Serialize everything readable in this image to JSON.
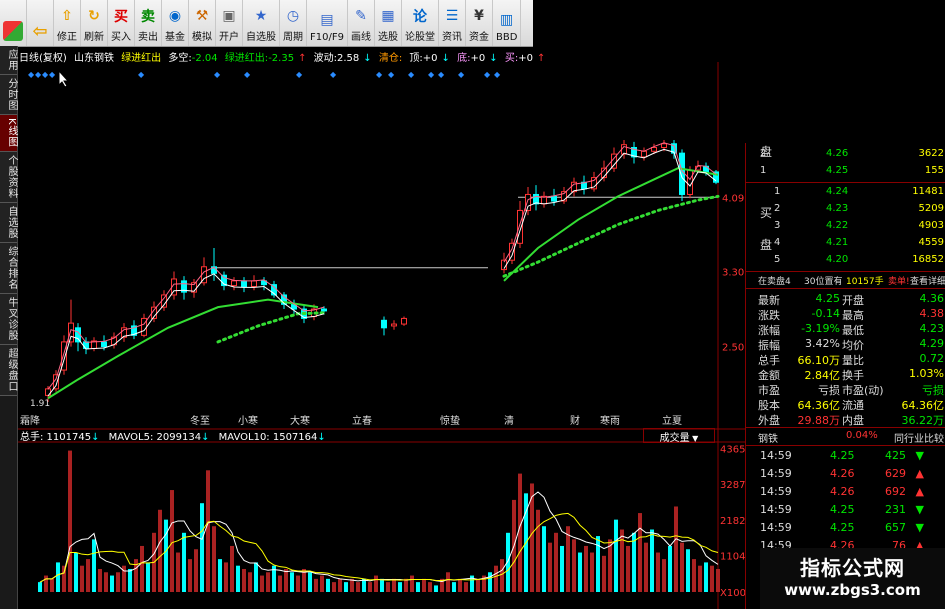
{
  "toolbar": {
    "items": [
      {
        "label": "",
        "icon": "window-icon"
      },
      {
        "label": "",
        "icon": "back-arrow-icon"
      },
      {
        "label": "修正",
        "icon": "up-arrow-icon"
      },
      {
        "label": "刷新",
        "icon": "refresh-icon"
      },
      {
        "label": "买入",
        "icon": "buy-icon",
        "glyph": "买"
      },
      {
        "label": "卖出",
        "icon": "sell-icon",
        "glyph": "卖"
      },
      {
        "label": "基金",
        "icon": "fund-icon"
      },
      {
        "label": "模拟",
        "icon": "hammer-icon"
      },
      {
        "label": "开户",
        "icon": "lock-icon"
      },
      {
        "label": "自选股",
        "icon": "star-icon"
      },
      {
        "label": "周期",
        "icon": "clock-icon"
      },
      {
        "label": "F10/F9",
        "icon": "f10-icon"
      },
      {
        "label": "画线",
        "icon": "pen-icon"
      },
      {
        "label": "选股",
        "icon": "screen-icon"
      },
      {
        "label": "论股堂",
        "icon": "discuss-icon",
        "glyph": "论"
      },
      {
        "label": "资讯",
        "icon": "news-icon"
      },
      {
        "label": "资金",
        "icon": "money-icon"
      },
      {
        "label": "BBD",
        "icon": "bbd-icon"
      }
    ]
  },
  "side_tabs": [
    "应用",
    "分时图",
    "K线图",
    "个股资料",
    "自选股",
    "综合排名",
    "牛叉诊股",
    "超级盘口"
  ],
  "indicator_line": {
    "period": "日线(复权)",
    "stock": "山东钢铁",
    "signal1": "绿进红出",
    "duokong": "多空:",
    "duokong_val": "-2.04",
    "signal2": "绿进红出:",
    "signal2_val": "-2.35",
    "bodong": "波动:",
    "bodong_val": "2.58",
    "qingcang": "清仓:",
    "ding": "顶:",
    "ding_val": "+0",
    "di": "底:",
    "di_val": "+0",
    "mai": "买:",
    "mai_val": "+0"
  },
  "price_axis": [
    "4.09",
    "3.30",
    "2.50"
  ],
  "low_label": "1.91",
  "date_labels": [
    "霜降",
    "冬至",
    "小寒",
    "大寒",
    "立春",
    "惊蛰",
    "清",
    "财",
    "寒雨",
    "立夏"
  ],
  "volume_header": {
    "total": "总手: 1101745",
    "mavol5": "MAVOL5: 2099134",
    "mavol10": "MAVOL10: 1507164",
    "dropdown": "成交量"
  },
  "volume_axis": [
    "43650",
    "32872",
    "21825",
    "11047",
    "X100"
  ],
  "order_book": {
    "side_sell": "盘",
    "side_buy1": "买",
    "side_buy2": "盘",
    "sell": [
      {
        "lvl": "2",
        "price": "4.26",
        "vol": "3622"
      },
      {
        "lvl": "1",
        "price": "4.25",
        "vol": "155"
      }
    ],
    "buy": [
      {
        "lvl": "1",
        "price": "4.24",
        "vol": "11481"
      },
      {
        "lvl": "2",
        "price": "4.23",
        "vol": "5209"
      },
      {
        "lvl": "3",
        "price": "4.22",
        "vol": "4903"
      },
      {
        "lvl": "4",
        "price": "4.21",
        "vol": "4559"
      },
      {
        "lvl": "5",
        "price": "4.20",
        "vol": "16852"
      }
    ]
  },
  "bar_row": {
    "a": "在卖盘4",
    "b": "30位置有",
    "c": "10157手",
    "d": "卖单!",
    "e": "查看详细"
  },
  "stats": [
    {
      "k1": "最新",
      "v1": "4.25",
      "k2": "开盘",
      "v2": "4.36"
    },
    {
      "k1": "涨跌",
      "v1": "-0.14",
      "k2": "最高",
      "v2": "4.38"
    },
    {
      "k1": "涨幅",
      "v1": "-3.19%",
      "k2": "最低",
      "v2": "4.23"
    },
    {
      "k1": "振幅",
      "v1": "3.42%",
      "k2": "均价",
      "v2": "4.29"
    },
    {
      "k1": "总手",
      "v1": "66.10万",
      "k2": "量比",
      "v2": "0.72"
    },
    {
      "k1": "金额",
      "v1": "2.84亿",
      "k2": "换手",
      "v2": "1.03%"
    },
    {
      "k1": "市盈",
      "v1": "亏损",
      "k2": "市盈(动)",
      "v2": "亏损"
    },
    {
      "k1": "股本",
      "v1": "64.36亿",
      "k2": "流通",
      "v2": "64.36亿"
    },
    {
      "k1": "外盘",
      "v1": "29.88万",
      "k2": "内盘",
      "v2": "36.22万"
    }
  ],
  "industry_row": {
    "name": "钢铁",
    "pct": "0.04%",
    "link": "同行业比较"
  },
  "ticks": [
    {
      "time": "14:59",
      "price": "4.25",
      "vol": "425",
      "dir": "down"
    },
    {
      "time": "14:59",
      "price": "4.26",
      "vol": "629",
      "dir": "up"
    },
    {
      "time": "14:59",
      "price": "4.26",
      "vol": "692",
      "dir": "up"
    },
    {
      "time": "14:59",
      "price": "4.25",
      "vol": "231",
      "dir": "down"
    },
    {
      "time": "14:59",
      "price": "4.25",
      "vol": "657",
      "dir": "down"
    },
    {
      "time": "14:59",
      "price": "4.26",
      "vol": "76",
      "dir": "up"
    }
  ],
  "watermark": {
    "line1": "指标公式网",
    "line2": "www.zbgs3.com"
  },
  "colors": {
    "up": "#ff3333",
    "down": "#00e600",
    "cyan": "#00ffff",
    "yellow": "#ffff00",
    "frame": "#880000"
  },
  "chart_data": {
    "type": "candlestick",
    "price_range": [
      1.91,
      4.7
    ],
    "x_range": [
      0,
      700
    ],
    "candles": [
      {
        "x": 30,
        "o": 1.98,
        "c": 2.05,
        "h": 2.08,
        "l": 1.91
      },
      {
        "x": 38,
        "o": 2.05,
        "c": 2.2,
        "h": 2.25,
        "l": 2.02
      },
      {
        "x": 46,
        "o": 2.25,
        "c": 2.55,
        "h": 2.62,
        "l": 2.2
      },
      {
        "x": 53,
        "o": 2.55,
        "c": 2.75,
        "h": 3.0,
        "l": 2.5
      },
      {
        "x": 60,
        "o": 2.7,
        "c": 2.55,
        "h": 2.75,
        "l": 2.45
      },
      {
        "x": 68,
        "o": 2.55,
        "c": 2.48,
        "h": 2.6,
        "l": 2.42
      },
      {
        "x": 76,
        "o": 2.48,
        "c": 2.56,
        "h": 2.6,
        "l": 2.45
      },
      {
        "x": 86,
        "o": 2.55,
        "c": 2.5,
        "h": 2.62,
        "l": 2.46
      },
      {
        "x": 96,
        "o": 2.52,
        "c": 2.6,
        "h": 2.65,
        "l": 2.48
      },
      {
        "x": 106,
        "o": 2.6,
        "c": 2.7,
        "h": 2.75,
        "l": 2.55
      },
      {
        "x": 116,
        "o": 2.72,
        "c": 2.62,
        "h": 2.78,
        "l": 2.58
      },
      {
        "x": 126,
        "o": 2.62,
        "c": 2.8,
        "h": 2.85,
        "l": 2.6
      },
      {
        "x": 136,
        "o": 2.8,
        "c": 2.92,
        "h": 2.98,
        "l": 2.76
      },
      {
        "x": 146,
        "o": 2.92,
        "c": 3.05,
        "h": 3.1,
        "l": 2.88
      },
      {
        "x": 156,
        "o": 3.05,
        "c": 3.22,
        "h": 3.3,
        "l": 3.0
      },
      {
        "x": 166,
        "o": 3.2,
        "c": 3.08,
        "h": 3.25,
        "l": 3.0
      },
      {
        "x": 176,
        "o": 3.08,
        "c": 3.18,
        "h": 3.22,
        "l": 3.02
      },
      {
        "x": 186,
        "o": 3.18,
        "c": 3.35,
        "h": 3.45,
        "l": 3.15
      },
      {
        "x": 196,
        "o": 3.35,
        "c": 3.28,
        "h": 3.55,
        "l": 3.2
      },
      {
        "x": 206,
        "o": 3.26,
        "c": 3.15,
        "h": 3.3,
        "l": 3.1
      },
      {
        "x": 216,
        "o": 3.15,
        "c": 3.2,
        "h": 3.24,
        "l": 3.1
      },
      {
        "x": 226,
        "o": 3.2,
        "c": 3.14,
        "h": 3.24,
        "l": 3.08
      },
      {
        "x": 236,
        "o": 3.14,
        "c": 3.2,
        "h": 3.26,
        "l": 3.1
      },
      {
        "x": 246,
        "o": 3.2,
        "c": 3.16,
        "h": 3.24,
        "l": 3.1
      },
      {
        "x": 256,
        "o": 3.16,
        "c": 3.05,
        "h": 3.2,
        "l": 3.02
      },
      {
        "x": 266,
        "o": 3.05,
        "c": 2.95,
        "h": 3.08,
        "l": 2.9
      },
      {
        "x": 276,
        "o": 2.95,
        "c": 2.9,
        "h": 3.0,
        "l": 2.85
      },
      {
        "x": 286,
        "o": 2.9,
        "c": 2.8,
        "h": 2.95,
        "l": 2.75
      },
      {
        "x": 296,
        "o": 2.82,
        "c": 2.9,
        "h": 2.95,
        "l": 2.78
      },
      {
        "x": 306,
        "o": 2.9,
        "c": 2.88,
        "h": 2.93,
        "l": 2.84
      },
      {
        "x": 366,
        "o": 2.78,
        "c": 2.7,
        "h": 2.82,
        "l": 2.62
      },
      {
        "x": 376,
        "o": 2.72,
        "c": 2.74,
        "h": 2.78,
        "l": 2.68
      },
      {
        "x": 386,
        "o": 2.74,
        "c": 2.8,
        "h": 2.82,
        "l": 2.72
      },
      {
        "x": 486,
        "o": 3.32,
        "c": 3.42,
        "h": 3.5,
        "l": 3.28
      },
      {
        "x": 494,
        "o": 3.42,
        "c": 3.6,
        "h": 3.65,
        "l": 3.38
      },
      {
        "x": 502,
        "o": 3.6,
        "c": 3.95,
        "h": 4.05,
        "l": 3.55
      },
      {
        "x": 510,
        "o": 3.95,
        "c": 4.12,
        "h": 4.2,
        "l": 3.9
      },
      {
        "x": 518,
        "o": 4.12,
        "c": 4.02,
        "h": 4.22,
        "l": 3.95
      },
      {
        "x": 526,
        "o": 4.02,
        "c": 4.1,
        "h": 4.15,
        "l": 3.98
      },
      {
        "x": 536,
        "o": 4.1,
        "c": 4.05,
        "h": 4.18,
        "l": 4.0
      },
      {
        "x": 546,
        "o": 4.05,
        "c": 4.15,
        "h": 4.2,
        "l": 4.02
      },
      {
        "x": 556,
        "o": 4.15,
        "c": 4.25,
        "h": 4.3,
        "l": 4.1
      },
      {
        "x": 566,
        "o": 4.25,
        "c": 4.18,
        "h": 4.32,
        "l": 4.12
      },
      {
        "x": 576,
        "o": 4.18,
        "c": 4.3,
        "h": 4.36,
        "l": 4.15
      },
      {
        "x": 586,
        "o": 4.3,
        "c": 4.4,
        "h": 4.48,
        "l": 4.26
      },
      {
        "x": 596,
        "o": 4.4,
        "c": 4.55,
        "h": 4.62,
        "l": 4.36
      },
      {
        "x": 606,
        "o": 4.55,
        "c": 4.65,
        "h": 4.7,
        "l": 4.5
      },
      {
        "x": 616,
        "o": 4.62,
        "c": 4.52,
        "h": 4.68,
        "l": 4.45
      },
      {
        "x": 626,
        "o": 4.52,
        "c": 4.58,
        "h": 4.62,
        "l": 4.48
      },
      {
        "x": 636,
        "o": 4.58,
        "c": 4.62,
        "h": 4.66,
        "l": 4.55
      },
      {
        "x": 646,
        "o": 4.62,
        "c": 4.66,
        "h": 4.7,
        "l": 4.58
      },
      {
        "x": 656,
        "o": 4.66,
        "c": 4.56,
        "h": 4.7,
        "l": 4.5
      },
      {
        "x": 664,
        "o": 4.56,
        "c": 4.12,
        "h": 4.6,
        "l": 4.05
      },
      {
        "x": 672,
        "o": 4.12,
        "c": 4.38,
        "h": 4.42,
        "l": 4.08
      },
      {
        "x": 680,
        "o": 4.38,
        "c": 4.42,
        "h": 4.48,
        "l": 4.35
      },
      {
        "x": 688,
        "o": 4.42,
        "c": 4.36,
        "h": 4.46,
        "l": 4.32
      },
      {
        "x": 698,
        "o": 4.36,
        "c": 4.25,
        "h": 4.38,
        "l": 4.23
      }
    ],
    "ma_green": [
      [
        30,
        1.95
      ],
      [
        60,
        2.15
      ],
      [
        100,
        2.4
      ],
      [
        150,
        2.7
      ],
      [
        200,
        2.92
      ],
      [
        250,
        3.0
      ],
      [
        300,
        2.92
      ],
      [
        486,
        3.2
      ],
      [
        520,
        3.55
      ],
      [
        560,
        3.85
      ],
      [
        600,
        4.1
      ],
      [
        640,
        4.3
      ],
      [
        660,
        4.4
      ],
      [
        700,
        4.33
      ]
    ],
    "ma_dots": [
      [
        200,
        2.55
      ],
      [
        240,
        2.72
      ],
      [
        280,
        2.85
      ],
      [
        306,
        2.86
      ],
      [
        486,
        3.25
      ],
      [
        520,
        3.4
      ],
      [
        560,
        3.6
      ],
      [
        600,
        3.8
      ],
      [
        640,
        3.95
      ],
      [
        680,
        4.06
      ],
      [
        700,
        4.1
      ]
    ],
    "volume": [
      {
        "x": 22,
        "v": 3
      },
      {
        "x": 28,
        "v": 5
      },
      {
        "x": 34,
        "v": 4
      },
      {
        "x": 40,
        "v": 9
      },
      {
        "x": 46,
        "v": 8
      },
      {
        "x": 52,
        "v": 43
      },
      {
        "x": 58,
        "v": 12
      },
      {
        "x": 64,
        "v": 8
      },
      {
        "x": 70,
        "v": 10
      },
      {
        "x": 76,
        "v": 16
      },
      {
        "x": 82,
        "v": 7
      },
      {
        "x": 88,
        "v": 6
      },
      {
        "x": 94,
        "v": 5
      },
      {
        "x": 100,
        "v": 6
      },
      {
        "x": 106,
        "v": 8
      },
      {
        "x": 112,
        "v": 7
      },
      {
        "x": 118,
        "v": 10
      },
      {
        "x": 124,
        "v": 14
      },
      {
        "x": 130,
        "v": 9
      },
      {
        "x": 136,
        "v": 18
      },
      {
        "x": 142,
        "v": 25
      },
      {
        "x": 148,
        "v": 22
      },
      {
        "x": 154,
        "v": 31
      },
      {
        "x": 160,
        "v": 12
      },
      {
        "x": 166,
        "v": 18
      },
      {
        "x": 172,
        "v": 10
      },
      {
        "x": 178,
        "v": 13
      },
      {
        "x": 184,
        "v": 27
      },
      {
        "x": 190,
        "v": 37
      },
      {
        "x": 196,
        "v": 20
      },
      {
        "x": 202,
        "v": 10
      },
      {
        "x": 208,
        "v": 9
      },
      {
        "x": 214,
        "v": 14
      },
      {
        "x": 220,
        "v": 8
      },
      {
        "x": 226,
        "v": 7
      },
      {
        "x": 232,
        "v": 6
      },
      {
        "x": 238,
        "v": 9
      },
      {
        "x": 244,
        "v": 5
      },
      {
        "x": 250,
        "v": 6
      },
      {
        "x": 256,
        "v": 8
      },
      {
        "x": 262,
        "v": 5
      },
      {
        "x": 268,
        "v": 7
      },
      {
        "x": 274,
        "v": 6
      },
      {
        "x": 280,
        "v": 5
      },
      {
        "x": 286,
        "v": 7
      },
      {
        "x": 292,
        "v": 6
      },
      {
        "x": 298,
        "v": 4
      },
      {
        "x": 304,
        "v": 5
      },
      {
        "x": 310,
        "v": 4
      },
      {
        "x": 316,
        "v": 3
      },
      {
        "x": 322,
        "v": 4
      },
      {
        "x": 328,
        "v": 3
      },
      {
        "x": 334,
        "v": 4
      },
      {
        "x": 340,
        "v": 3
      },
      {
        "x": 346,
        "v": 4
      },
      {
        "x": 352,
        "v": 3
      },
      {
        "x": 358,
        "v": 5
      },
      {
        "x": 364,
        "v": 4
      },
      {
        "x": 370,
        "v": 3
      },
      {
        "x": 376,
        "v": 4
      },
      {
        "x": 382,
        "v": 3
      },
      {
        "x": 388,
        "v": 4
      },
      {
        "x": 394,
        "v": 5
      },
      {
        "x": 400,
        "v": 3
      },
      {
        "x": 406,
        "v": 4
      },
      {
        "x": 412,
        "v": 3
      },
      {
        "x": 418,
        "v": 2
      },
      {
        "x": 424,
        "v": 4
      },
      {
        "x": 430,
        "v": 6
      },
      {
        "x": 436,
        "v": 3
      },
      {
        "x": 442,
        "v": 4
      },
      {
        "x": 448,
        "v": 3
      },
      {
        "x": 454,
        "v": 5
      },
      {
        "x": 460,
        "v": 4
      },
      {
        "x": 466,
        "v": 5
      },
      {
        "x": 472,
        "v": 6
      },
      {
        "x": 478,
        "v": 8
      },
      {
        "x": 484,
        "v": 10
      },
      {
        "x": 490,
        "v": 18
      },
      {
        "x": 496,
        "v": 28
      },
      {
        "x": 502,
        "v": 36
      },
      {
        "x": 508,
        "v": 30
      },
      {
        "x": 514,
        "v": 33
      },
      {
        "x": 520,
        "v": 25
      },
      {
        "x": 526,
        "v": 20
      },
      {
        "x": 532,
        "v": 15
      },
      {
        "x": 538,
        "v": 18
      },
      {
        "x": 544,
        "v": 14
      },
      {
        "x": 550,
        "v": 20
      },
      {
        "x": 556,
        "v": 16
      },
      {
        "x": 562,
        "v": 12
      },
      {
        "x": 568,
        "v": 14
      },
      {
        "x": 574,
        "v": 12
      },
      {
        "x": 580,
        "v": 17
      },
      {
        "x": 586,
        "v": 11
      },
      {
        "x": 592,
        "v": 16
      },
      {
        "x": 598,
        "v": 22
      },
      {
        "x": 604,
        "v": 19
      },
      {
        "x": 610,
        "v": 14
      },
      {
        "x": 616,
        "v": 18
      },
      {
        "x": 622,
        "v": 24
      },
      {
        "x": 628,
        "v": 15
      },
      {
        "x": 634,
        "v": 19
      },
      {
        "x": 640,
        "v": 12
      },
      {
        "x": 646,
        "v": 10
      },
      {
        "x": 652,
        "v": 14
      },
      {
        "x": 658,
        "v": 26
      },
      {
        "x": 664,
        "v": 15
      },
      {
        "x": 670,
        "v": 13
      },
      {
        "x": 676,
        "v": 10
      },
      {
        "x": 682,
        "v": 8
      },
      {
        "x": 688,
        "v": 9
      },
      {
        "x": 694,
        "v": 8
      },
      {
        "x": 700,
        "v": 7
      }
    ],
    "vol_range": [
      0,
      45
    ]
  }
}
